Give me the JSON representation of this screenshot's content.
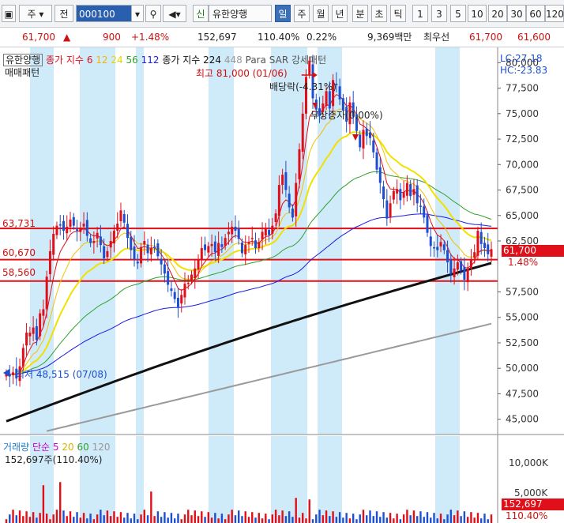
{
  "toolbar": {
    "market": "주",
    "mode": "전",
    "code": "000100",
    "name": "유한양행",
    "sin": "신",
    "periods": [
      "일",
      "주",
      "월",
      "년",
      "분",
      "초",
      "틱"
    ],
    "selected_period": "일",
    "nums": [
      "1",
      "3",
      "5",
      "10",
      "20",
      "30",
      "60",
      "120"
    ]
  },
  "quote": {
    "price": "61,700",
    "arrow": "▲",
    "change": "900",
    "change_pct": "+1.48%",
    "volume": "152,697",
    "vol_ratio": "110.40%",
    "turnover": "0.22%",
    "amount": "9,369백만",
    "ask_label": "최우선",
    "best_ask": "61,700",
    "best_bid": "61,600"
  },
  "legend": {
    "title": "유한양행",
    "line2": "매매패턴",
    "sma_label": "종가 지수",
    "sma_periods": [
      "6",
      "12",
      "24",
      "56",
      "112"
    ],
    "long_label": "종가 지수",
    "long_periods": [
      "224",
      "448"
    ],
    "sar": "Para SAR 강세패턴",
    "lc": "LC:27.18",
    "hc": "HC:-23.83"
  },
  "annotations": {
    "high": "최고 81,000 (01/06)",
    "dividend": "배당락(-4.31%)",
    "rights": "무상증자(0,00%)",
    "low": "최저 48,515 (07/08)",
    "level_labels": [
      "63,731",
      "60,670",
      "58,560"
    ]
  },
  "price_tag": {
    "value": "61,700",
    "pct": "1.48%"
  },
  "volume_legend": {
    "label": "거래량",
    "sma_label": "단순",
    "periods": [
      "5",
      "20",
      "60",
      "120"
    ],
    "value": "152,697주(110.40%)",
    "axis": [
      "10,000K",
      "5,000K"
    ],
    "tag": "152,697",
    "tag_pct": "110.40%"
  },
  "colors": {
    "up": "#e0101a",
    "down": "#1d4fd0",
    "sma6": "#e0101a",
    "sma12": "#f2c200",
    "sma24": "#f2e000",
    "sma56": "#31a02c",
    "sma112": "#1a1ae6",
    "sma224": "#111111",
    "sma448": "#9a9a9a",
    "shade": "#bfe3f7"
  },
  "chart_data": {
    "type": "candlestick",
    "title": "유한양행",
    "ylim": [
      43500,
      81500
    ],
    "y_ticks": [
      45000,
      47500,
      50000,
      52500,
      55000,
      57500,
      62500,
      65000,
      67500,
      70000,
      72500,
      75000,
      77500,
      80000
    ],
    "y_tick_labels": [
      "45,000",
      "47,500",
      "50,000",
      "52,500",
      "55,000",
      "57,500",
      "62,500",
      "65,000",
      "67,500",
      "70,000",
      "72,500",
      "75,000",
      "77,500",
      "80,000"
    ],
    "horizontal_levels": [
      63731,
      60670,
      58560
    ],
    "high": {
      "value": 81000,
      "date": "01/06"
    },
    "low": {
      "value": 48515,
      "date": "07/08"
    },
    "last_price": 61700,
    "close_path": [
      49500,
      49200,
      49600,
      49000,
      50200,
      52000,
      53500,
      53500,
      54000,
      52800,
      55400,
      55800,
      59000,
      61500,
      63200,
      64000,
      64100,
      63500,
      63900,
      64600,
      64000,
      63500,
      63800,
      64200,
      63000,
      62300,
      62500,
      63300,
      62100,
      60800,
      61500,
      62500,
      63500,
      64200,
      65500,
      64300,
      62800,
      61600,
      60700,
      60300,
      61900,
      62500,
      61300,
      61800,
      61900,
      61000,
      60200,
      59300,
      58200,
      57600,
      56800,
      56000,
      57200,
      58300,
      58400,
      59200,
      59800,
      60600,
      61800,
      61600,
      62000,
      62200,
      61400,
      62300,
      61900,
      62800,
      63400,
      63900,
      63500,
      62700,
      61300,
      62100,
      62400,
      62800,
      61800,
      62400,
      63400,
      63700,
      63100,
      64000,
      65200,
      68000,
      69000,
      67500,
      65800,
      64800,
      68200,
      71500,
      75000,
      78600,
      80200,
      76500,
      75400,
      74800,
      76000,
      77200,
      75500,
      78300,
      77800,
      76400,
      75300,
      74200,
      76100,
      74700,
      73300,
      71700,
      73400,
      72800,
      72600,
      71200,
      69500,
      68200,
      66600,
      64700,
      66200,
      67400,
      67600,
      66500,
      67300,
      68200,
      66900,
      67600,
      66200,
      65900,
      64800,
      63300,
      62000,
      61800,
      61600,
      62400,
      61600,
      60400,
      59300,
      59800,
      60400,
      59600,
      58700,
      59800,
      60600,
      61400,
      63500,
      62200,
      61800,
      61200,
      61700
    ]
  }
}
